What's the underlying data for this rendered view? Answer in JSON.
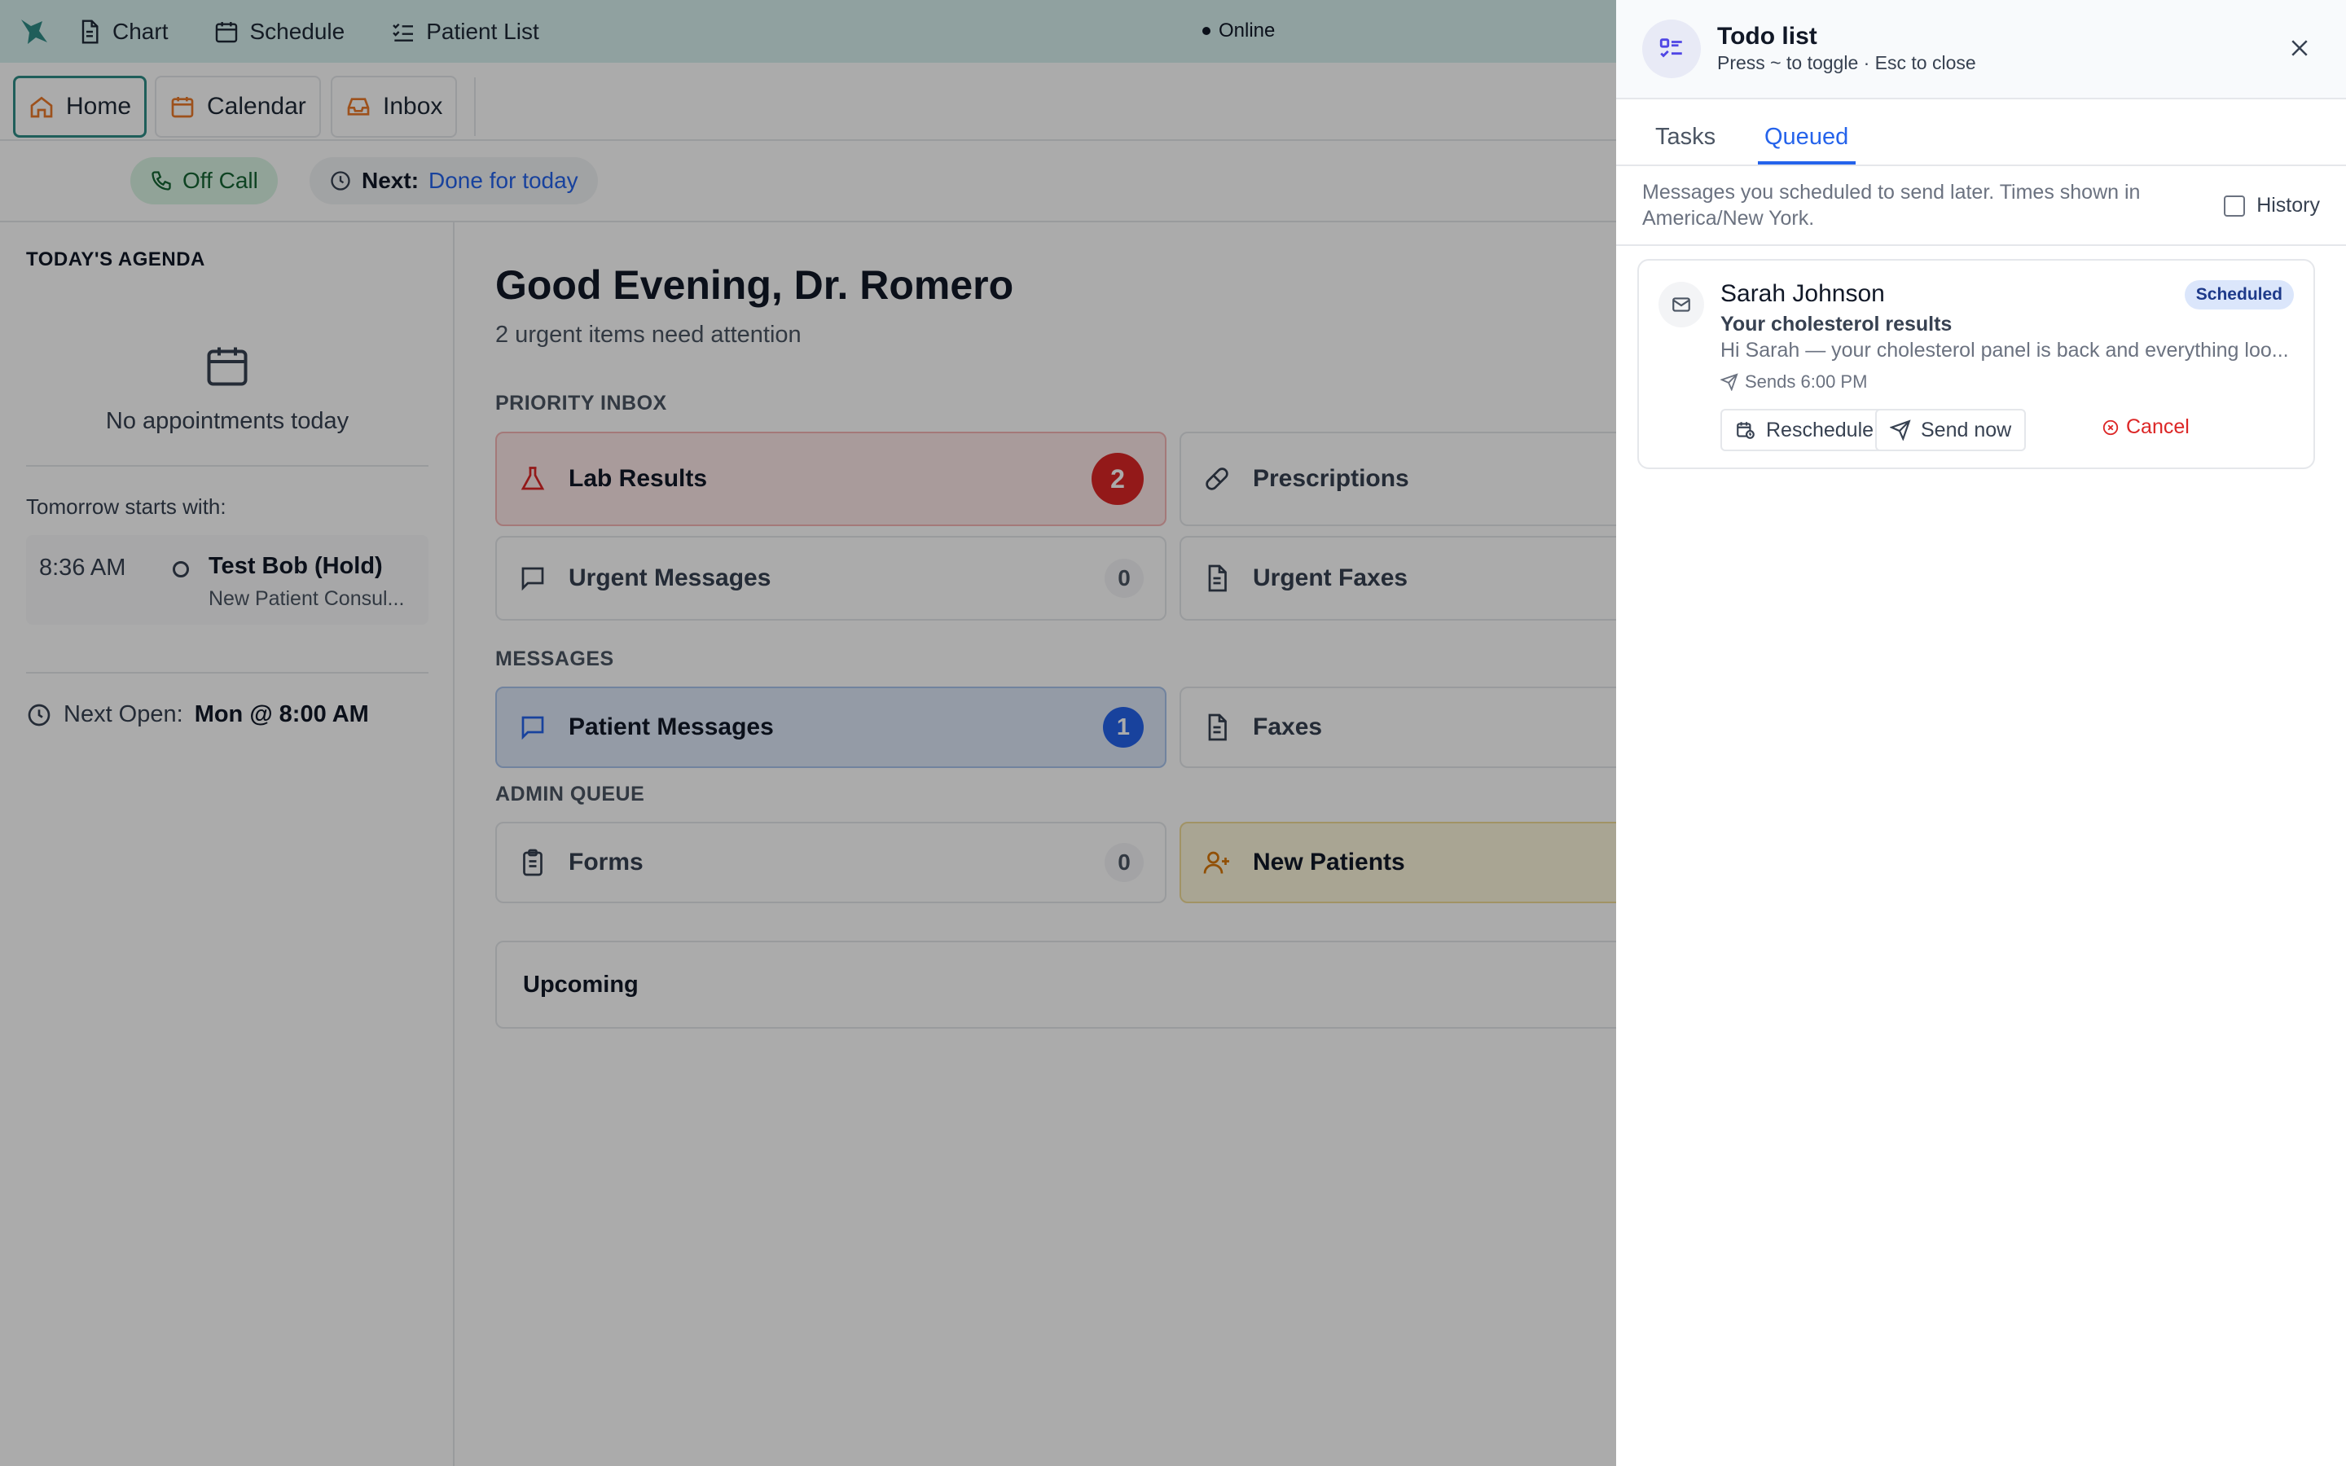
{
  "topbar": {
    "nav": [
      {
        "label": "Chart",
        "icon": "document-icon"
      },
      {
        "label": "Schedule",
        "icon": "calendar-icon"
      },
      {
        "label": "Patient List",
        "icon": "list-check-icon"
      }
    ],
    "status": "Online"
  },
  "tabs": [
    {
      "label": "Home",
      "icon": "home-icon",
      "active": true
    },
    {
      "label": "Calendar",
      "icon": "calendar-icon",
      "active": false
    },
    {
      "label": "Inbox",
      "icon": "inbox-icon",
      "active": false
    }
  ],
  "status_row": {
    "call_status": "Off Call",
    "next_prefix": "Next:",
    "next_value": "Done for today"
  },
  "agenda": {
    "title": "TODAY'S AGENDA",
    "empty_text": "No appointments today",
    "tomorrow_label": "Tomorrow starts with:",
    "tomorrow_time": "8:36 AM",
    "tomorrow_patient": "Test Bob (Hold)",
    "tomorrow_type": "New Patient Consul...",
    "next_open_label": "Next Open:",
    "next_open_value": "Mon @ 8:00 AM"
  },
  "main": {
    "greeting": "Good Evening, Dr. Romero",
    "subtitle": "2 urgent items need attention",
    "sections": {
      "priority": "PRIORITY INBOX",
      "messages": "MESSAGES",
      "admin": "ADMIN QUEUE"
    },
    "cards": {
      "lab_results": {
        "label": "Lab Results",
        "count": "2"
      },
      "prescriptions": {
        "label": "Prescriptions"
      },
      "urgent_messages": {
        "label": "Urgent Messages",
        "count": "0"
      },
      "urgent_faxes": {
        "label": "Urgent Faxes"
      },
      "patient_messages": {
        "label": "Patient Messages",
        "count": "1"
      },
      "faxes": {
        "label": "Faxes"
      },
      "forms": {
        "label": "Forms",
        "count": "0"
      },
      "new_patients": {
        "label": "New Patients"
      }
    },
    "upcoming": "Upcoming"
  },
  "drawer": {
    "title": "Todo list",
    "hint": "Press  ~  to toggle · Esc to close",
    "tabs": [
      "Tasks",
      "Queued"
    ],
    "active_tab": "Queued",
    "info": "Messages you scheduled to send later. Times shown in America/New York.",
    "history_label": "History",
    "history_checked": false,
    "queued": [
      {
        "recipient": "Sarah Johnson",
        "status": "Scheduled",
        "subject": "Your cholesterol results",
        "preview": "Hi Sarah — your cholesterol panel is back and everything loo...",
        "sends": "Sends 6:00 PM",
        "actions": {
          "reschedule": "Reschedule",
          "send_now": "Send now",
          "cancel": "Cancel"
        }
      }
    ]
  },
  "colors": {
    "brand_teal": "#2f8c86",
    "accent_blue": "#2563eb",
    "danger_red": "#dc2626",
    "success_green": "#166534",
    "icon_orange": "#ea7a2a"
  }
}
